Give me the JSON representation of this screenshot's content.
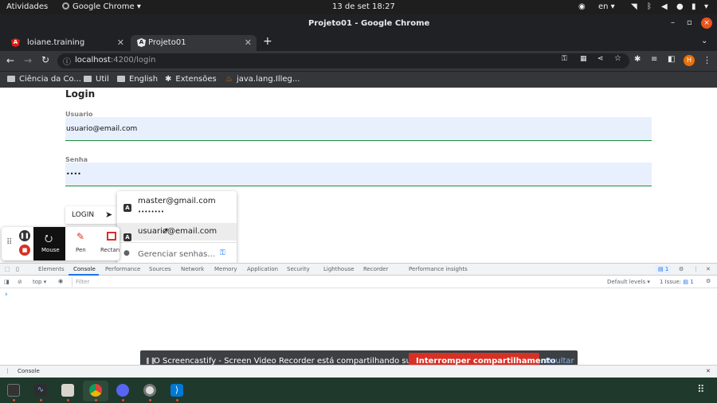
{
  "system": {
    "activities": "Atividades",
    "app_menu": "Google Chrome",
    "clock": "13 de set  18:27",
    "lang": "en"
  },
  "window": {
    "title": "Projeto01 - Google Chrome"
  },
  "tabs": [
    {
      "label": "loiane.training",
      "active": false
    },
    {
      "label": "Projeto01",
      "active": true
    }
  ],
  "address": {
    "host": "localhost",
    "path": ":4200/login"
  },
  "profile_initial": "H",
  "bookmarks": [
    "Ciência da Co...",
    "Util",
    "English",
    "Extensões",
    "java.lang.Illeg..."
  ],
  "page": {
    "heading": "Login",
    "user_label": "Usuario",
    "user_value": "usuario@email.com",
    "pass_label": "Senha",
    "pass_value": "••••",
    "login_button": "LOGIN"
  },
  "autofill": {
    "items": [
      {
        "email": "master@gmail.com",
        "mask": "••••••••"
      },
      {
        "email": "usuario@email.com",
        "mask": ""
      }
    ],
    "manage": "Gerenciar senhas..."
  },
  "capture_tools": {
    "mouse": "Mouse",
    "pen": "Pen",
    "rect": "Rectan"
  },
  "devtools": {
    "tabs": [
      "Elements",
      "Console",
      "Performance",
      "Sources",
      "Network",
      "Memory",
      "Application",
      "Security",
      "Lighthouse",
      "Recorder",
      "Performance insights"
    ],
    "active_tab": "Console",
    "badge": "1",
    "context": "top",
    "filter_placeholder": "Filter",
    "levels": "Default levels",
    "issues": "1 Issue:",
    "issues_count": "1",
    "prompt": "›",
    "drawer_tab": "Console"
  },
  "sharebar": {
    "message": "O Screencastify - Screen Video Recorder está compartilhando sua tela.",
    "stop": "Interromper compartilhamento",
    "hide": "Ocultar"
  },
  "colors": {
    "accent_green": "#1e8e3e",
    "stop_red": "#d93025",
    "link_blue": "#8ab4f8",
    "profile_orange": "#e8710a"
  }
}
